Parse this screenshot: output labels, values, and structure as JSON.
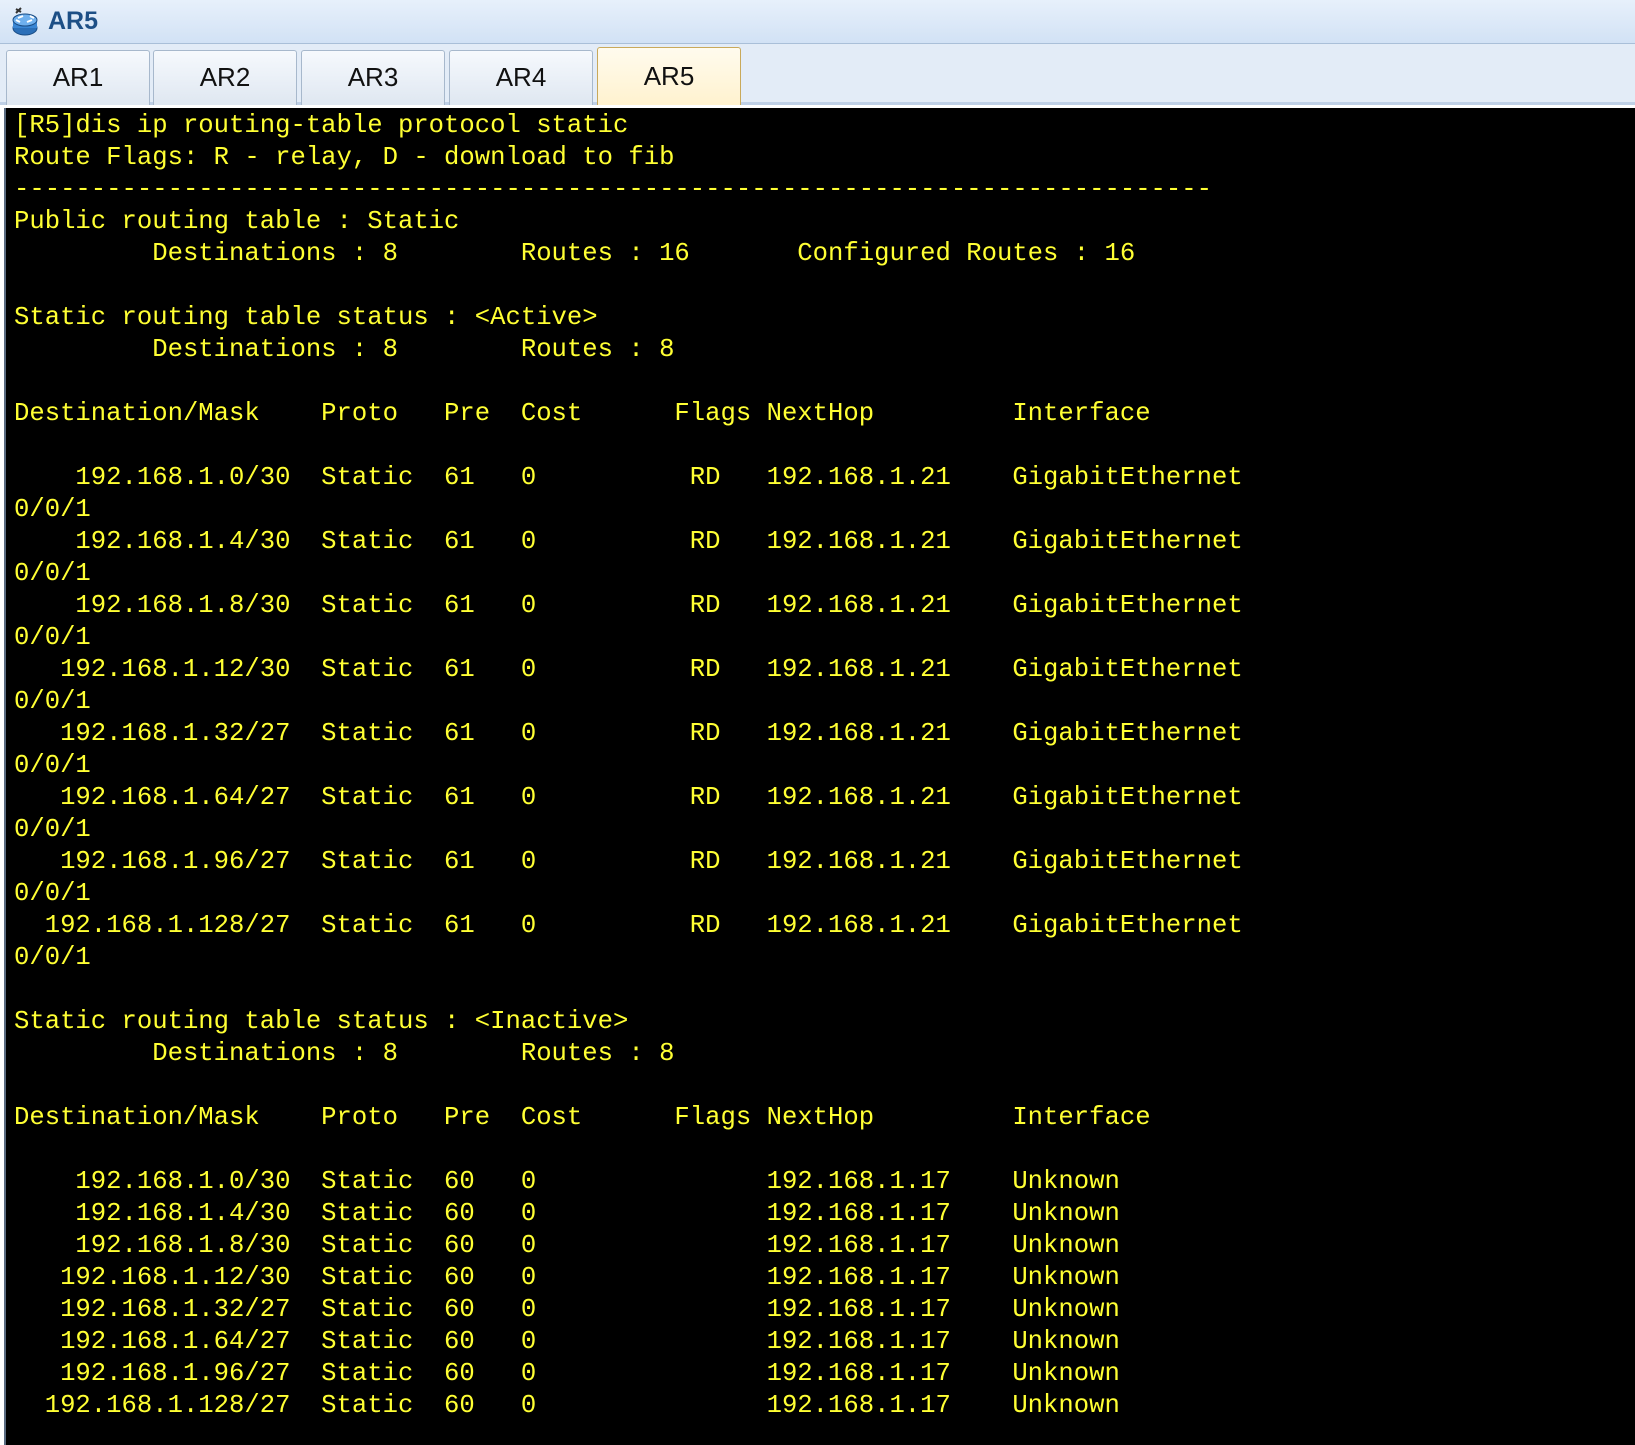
{
  "window": {
    "title": "AR5",
    "icon": "router-icon"
  },
  "tabs": [
    {
      "label": "AR1",
      "active": false
    },
    {
      "label": "AR2",
      "active": false
    },
    {
      "label": "AR3",
      "active": false
    },
    {
      "label": "AR4",
      "active": false
    },
    {
      "label": "AR5",
      "active": true
    }
  ],
  "colors": {
    "console_background": "#000000",
    "console_text": "#ffff33",
    "title_text": "#1d4f86"
  },
  "console": {
    "lines": [
      "[R5]dis ip routing-table protocol static",
      "Route Flags: R - relay, D - download to fib",
      "------------------------------------------------------------------------------",
      "Public routing table : Static",
      "         Destinations : 8        Routes : 16       Configured Routes : 16",
      "",
      "Static routing table status : <Active>",
      "         Destinations : 8        Routes : 8",
      "",
      "Destination/Mask    Proto   Pre  Cost      Flags NextHop         Interface",
      "",
      "    192.168.1.0/30  Static  61   0          RD   192.168.1.21    GigabitEthernet",
      "0/0/1",
      "    192.168.1.4/30  Static  61   0          RD   192.168.1.21    GigabitEthernet",
      "0/0/1",
      "    192.168.1.8/30  Static  61   0          RD   192.168.1.21    GigabitEthernet",
      "0/0/1",
      "   192.168.1.12/30  Static  61   0          RD   192.168.1.21    GigabitEthernet",
      "0/0/1",
      "   192.168.1.32/27  Static  61   0          RD   192.168.1.21    GigabitEthernet",
      "0/0/1",
      "   192.168.1.64/27  Static  61   0          RD   192.168.1.21    GigabitEthernet",
      "0/0/1",
      "   192.168.1.96/27  Static  61   0          RD   192.168.1.21    GigabitEthernet",
      "0/0/1",
      "  192.168.1.128/27  Static  61   0          RD   192.168.1.21    GigabitEthernet",
      "0/0/1",
      "",
      "Static routing table status : <Inactive>",
      "         Destinations : 8        Routes : 8",
      "",
      "Destination/Mask    Proto   Pre  Cost      Flags NextHop         Interface",
      "",
      "    192.168.1.0/30  Static  60   0               192.168.1.17    Unknown",
      "    192.168.1.4/30  Static  60   0               192.168.1.17    Unknown",
      "    192.168.1.8/30  Static  60   0               192.168.1.17    Unknown",
      "   192.168.1.12/30  Static  60   0               192.168.1.17    Unknown",
      "   192.168.1.32/27  Static  60   0               192.168.1.17    Unknown",
      "   192.168.1.64/27  Static  60   0               192.168.1.17    Unknown",
      "   192.168.1.96/27  Static  60   0               192.168.1.17    Unknown",
      "  192.168.1.128/27  Static  60   0               192.168.1.17    Unknown"
    ]
  }
}
